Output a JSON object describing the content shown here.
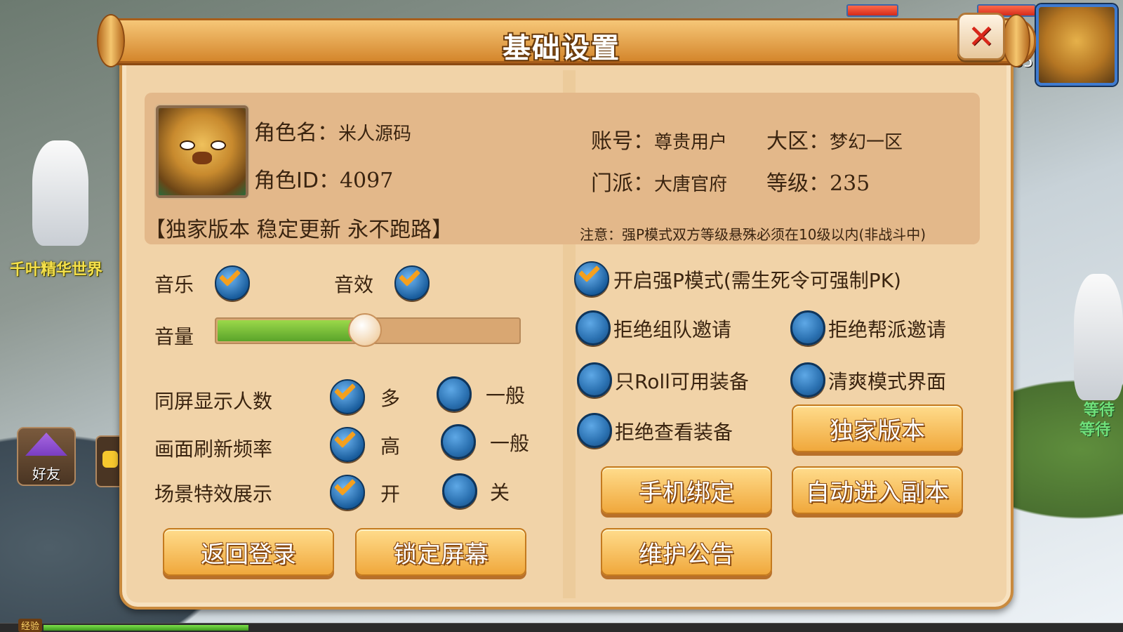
{
  "panel": {
    "title": "基础设置"
  },
  "profile": {
    "name_label": "角色名：",
    "name_value": "米人源码",
    "id_label": "角色ID：",
    "id_value": "4097",
    "account_label": "账号：",
    "account_value": "尊贵用户",
    "region_label": "大区：",
    "region_value": "梦幻一区",
    "school_label": "门派：",
    "school_value": "大唐官府",
    "level_label": "等级：",
    "level_value": "235",
    "slogan": "【独家版本  稳定更新  永不跑路】",
    "notice": "注意：强P模式双方等级悬殊必须在10级以内(非战斗中)"
  },
  "audio": {
    "music_label": "音乐",
    "music_checked": true,
    "sfx_label": "音效",
    "sfx_checked": true,
    "volume_label": "音量",
    "volume_fraction": 0.49
  },
  "display_settings": [
    {
      "label": "同屏显示人数",
      "option_a": "多",
      "option_b": "一般",
      "selected": "a"
    },
    {
      "label": "画面刷新频率",
      "option_a": "高",
      "option_b": "一般",
      "selected": "a"
    },
    {
      "label": "场景特效展示",
      "option_a": "开",
      "option_b": "关",
      "selected": "a"
    }
  ],
  "toggles": {
    "force_pk": {
      "label": "开启强P模式(需生死令可强制PK)",
      "checked": true
    },
    "refuse_team": {
      "label": "拒绝组队邀请",
      "checked": false
    },
    "refuse_guild": {
      "label": "拒绝帮派邀请",
      "checked": false
    },
    "roll_usable": {
      "label": "只Roll可用装备",
      "checked": false
    },
    "clean_ui": {
      "label": "清爽模式界面",
      "checked": false
    },
    "refuse_inspect": {
      "label": "拒绝查看装备",
      "checked": false
    }
  },
  "buttons": {
    "back_login": "返回登录",
    "lock_screen": "锁定屏幕",
    "exclusive": "独家版本",
    "bind_phone": "手机绑定",
    "auto_dungeon": "自动进入副本",
    "maintenance": "维护公告"
  },
  "hud": {
    "level_fragment": "35",
    "friend_label": "好友",
    "exp_label": "经验",
    "exp_fraction": 0.19
  },
  "background": {
    "player_title": "千叶精华世界",
    "waiting_text_1": "等待",
    "waiting_text_2": "等待"
  },
  "colors": {
    "panel_bg": "#f1d3a8",
    "button_gradient_top": "#ffdc8c",
    "button_gradient_bottom": "#f0a83c",
    "close_red": "#d9271a",
    "slider_green": "#5aa42a",
    "radio_blue": "#2a70b0"
  }
}
